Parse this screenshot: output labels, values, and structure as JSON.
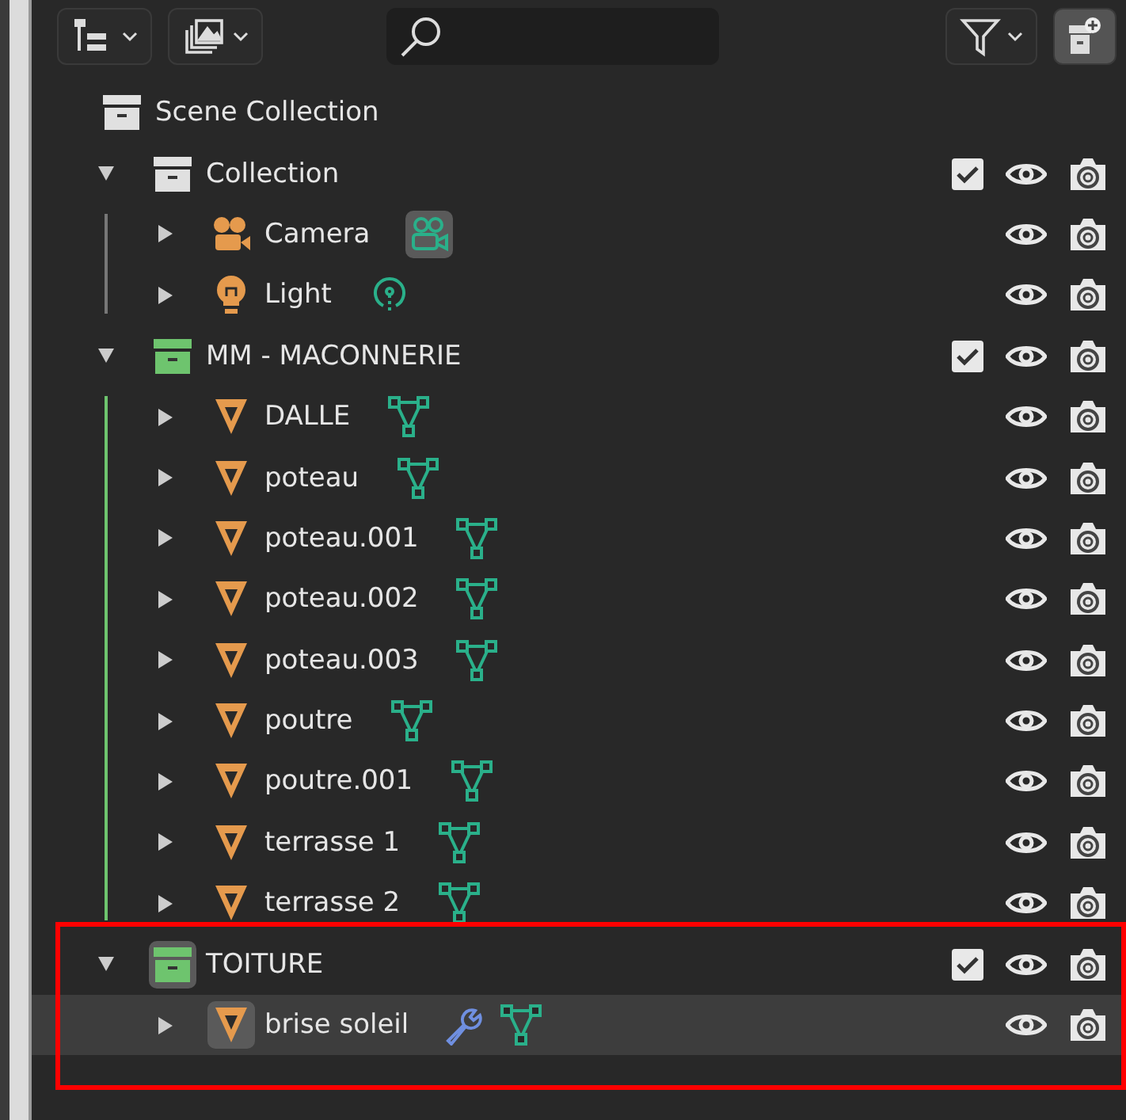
{
  "tree": {
    "name": "Scene Collection",
    "kind": "scene",
    "children": [
      {
        "name": "Collection",
        "kind": "collection",
        "color": "#e0e0e0",
        "expanded": true,
        "checked": true,
        "active": false,
        "selected": false,
        "children": [
          {
            "name": "Camera",
            "kind": "camera",
            "selected": false,
            "active": false,
            "data_active": true,
            "modifier": false
          },
          {
            "name": "Light",
            "kind": "light",
            "selected": false,
            "active": false,
            "data_active": false,
            "modifier": false
          }
        ]
      },
      {
        "name": "MM - MACONNERIE",
        "kind": "collection",
        "color": "#6ec46e",
        "expanded": true,
        "checked": true,
        "active": false,
        "selected": false,
        "children": [
          {
            "name": "DALLE",
            "kind": "mesh",
            "selected": false,
            "active": false,
            "data_active": false,
            "modifier": false
          },
          {
            "name": "poteau",
            "kind": "mesh",
            "selected": false,
            "active": false,
            "data_active": false,
            "modifier": false
          },
          {
            "name": "poteau.001",
            "kind": "mesh",
            "selected": false,
            "active": false,
            "data_active": false,
            "modifier": false
          },
          {
            "name": "poteau.002",
            "kind": "mesh",
            "selected": false,
            "active": false,
            "data_active": false,
            "modifier": false
          },
          {
            "name": "poteau.003",
            "kind": "mesh",
            "selected": false,
            "active": false,
            "data_active": false,
            "modifier": false
          },
          {
            "name": "poutre",
            "kind": "mesh",
            "selected": false,
            "active": false,
            "data_active": false,
            "modifier": false
          },
          {
            "name": "poutre.001",
            "kind": "mesh",
            "selected": false,
            "active": false,
            "data_active": false,
            "modifier": false
          },
          {
            "name": "terrasse 1",
            "kind": "mesh",
            "selected": false,
            "active": false,
            "data_active": false,
            "modifier": false
          },
          {
            "name": "terrasse 2",
            "kind": "mesh",
            "selected": false,
            "active": false,
            "data_active": false,
            "modifier": false
          }
        ]
      },
      {
        "name": "TOITURE",
        "kind": "collection",
        "color": "#6ec46e",
        "expanded": true,
        "checked": true,
        "active": true,
        "selected": false,
        "children": [
          {
            "name": "brise soleil",
            "kind": "mesh",
            "selected": true,
            "active": true,
            "data_active": false,
            "modifier": true
          }
        ]
      }
    ]
  }
}
